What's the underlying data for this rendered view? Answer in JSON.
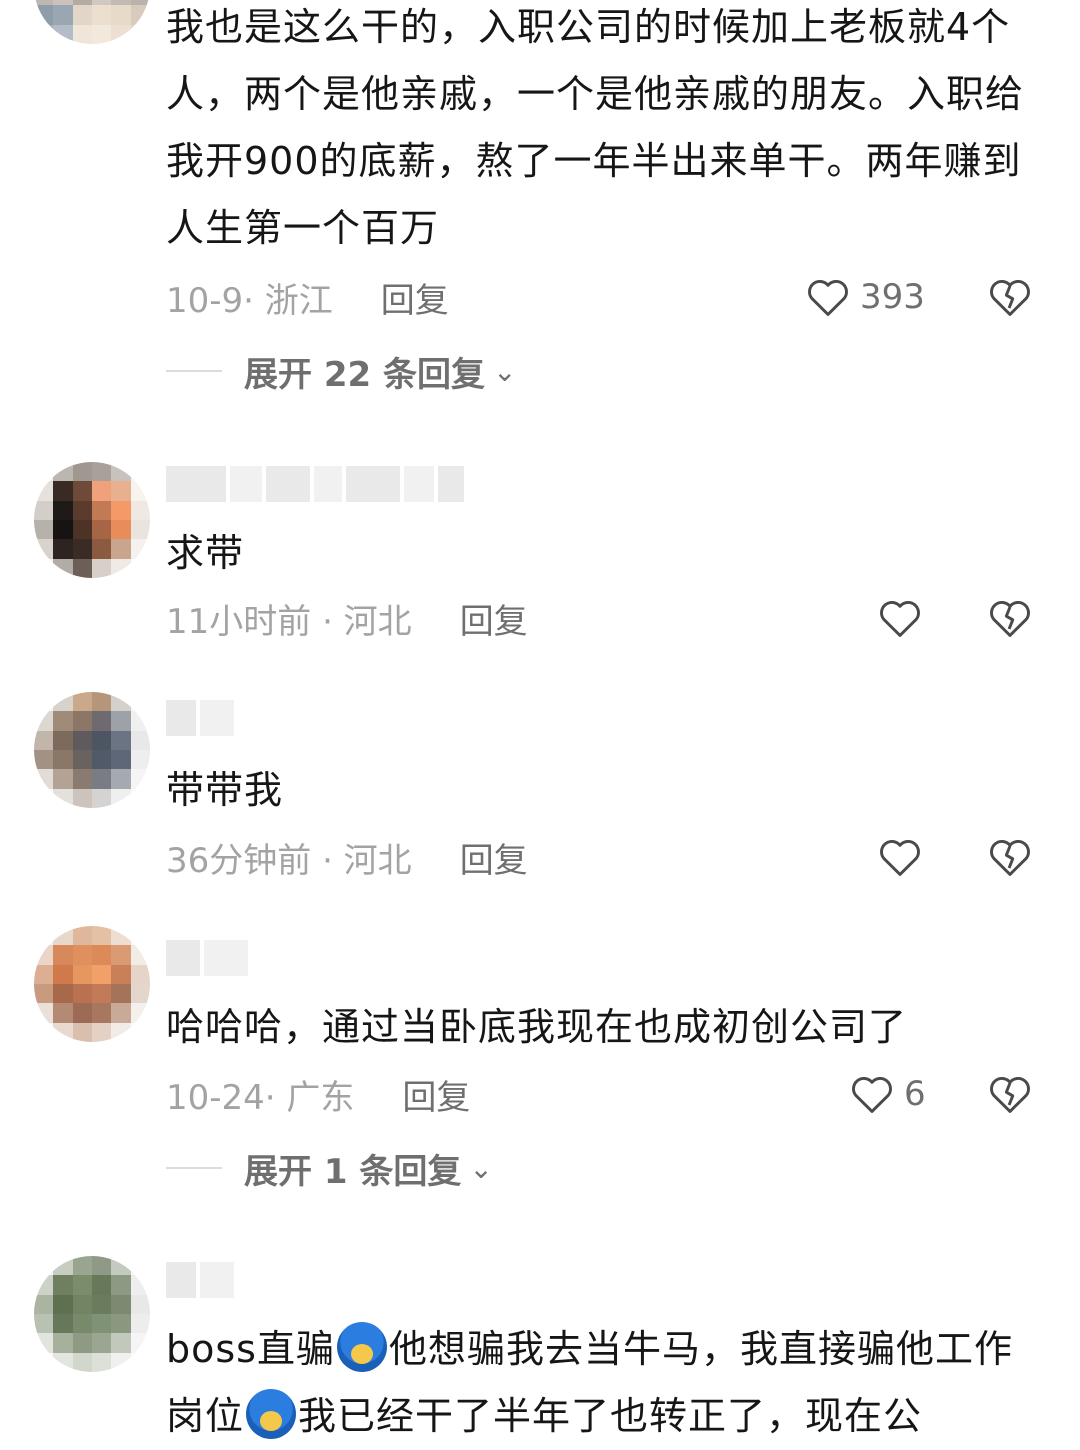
{
  "comments": [
    {
      "text": "我也是这么干的，入职公司的时候加上老板就4个人，两个是他亲戚，一个是他亲戚的朋友。入职给我开900的底薪，熬了一年半出来单干。两年赚到人生第一个百万",
      "meta": "10-9· 浙江",
      "reply_label": "回复",
      "likes": "393",
      "expand_label": "展开 22 条回复"
    },
    {
      "text": "求带",
      "meta": "11小时前 · 河北",
      "reply_label": "回复",
      "likes": ""
    },
    {
      "text": "带带我",
      "meta": "36分钟前 · 河北",
      "reply_label": "回复",
      "likes": ""
    },
    {
      "text": "哈哈哈，通过当卧底我现在也成初创公司了",
      "meta": "10-24· 广东",
      "reply_label": "回复",
      "likes": "6",
      "expand_label": "展开 1 条回复"
    },
    {
      "text_part1": "boss直骗",
      "text_part2": "他想骗我去当牛马，我直接骗他工作岗位",
      "text_part3": "我已经干了半年了也转正了，现在公",
      "emoji_name": "blue-face-emoji"
    }
  ],
  "icons": {
    "like": "heart-outline-icon",
    "dislike": "broken-heart-icon",
    "expand": "chevron-down-icon"
  },
  "colors": {
    "text": "#161616",
    "meta": "#a3a3a3",
    "action": "#6f6f6f"
  }
}
